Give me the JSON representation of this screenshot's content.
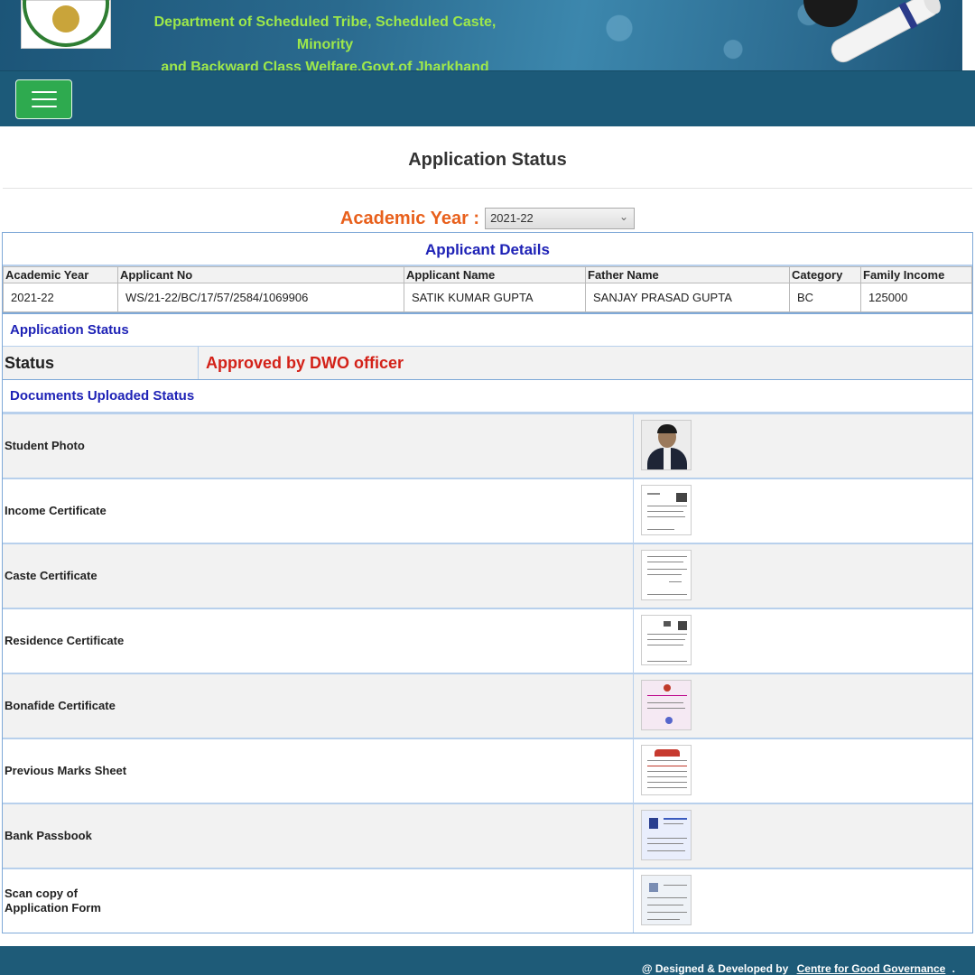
{
  "header": {
    "dept_line1": "Department of Scheduled Tribe, Scheduled Caste, Minority",
    "dept_line2": "and Backward Class Welfare,Govt.of Jharkhand",
    "emblem_icon": "jharkhand-emblem-icon",
    "colors": {
      "banner": "#2a6a8e",
      "dept_text": "#9ee84a",
      "navbar": "#1c5a79",
      "menu_button": "#2eaa4f"
    }
  },
  "navbar": {
    "menu_icon": "hamburger-menu-icon"
  },
  "page": {
    "title": "Application Status",
    "academic_year_label": "Academic Year :",
    "academic_year_selected": "2021-22"
  },
  "applicant": {
    "section_title": "Applicant Details",
    "columns": [
      "Academic Year",
      "Applicant No",
      "Applicant Name",
      "Father Name",
      "Category",
      "Family Income"
    ],
    "row": [
      "2021-22",
      "WS/21-22/BC/17/57/2584/1069906",
      "SATIK KUMAR GUPTA",
      "SANJAY PRASAD GUPTA",
      "BC",
      "125000"
    ]
  },
  "application_status": {
    "section_title": "Application Status",
    "label": "Status",
    "value": "Approved by DWO officer",
    "value_color": "#d32118"
  },
  "documents": {
    "section_title": "Documents Uploaded Status",
    "items": [
      {
        "label": "Student Photo",
        "thumb": "student-photo-thumbnail"
      },
      {
        "label": "Income Certificate",
        "thumb": "income-certificate-thumbnail"
      },
      {
        "label": "Caste Certificate",
        "thumb": "caste-certificate-thumbnail"
      },
      {
        "label": "Residence Certificate",
        "thumb": "residence-certificate-thumbnail"
      },
      {
        "label": "Bonafide Certificate",
        "thumb": "bonafide-certificate-thumbnail"
      },
      {
        "label": "Previous Marks Sheet",
        "thumb": "marks-sheet-thumbnail"
      },
      {
        "label": "Bank Passbook",
        "thumb": "bank-passbook-thumbnail"
      },
      {
        "label": "Scan copy of\nApplication Form",
        "thumb": "application-form-thumbnail"
      }
    ]
  },
  "footer": {
    "prefix": "@ Designed & Developed by",
    "link": "Centre for Good Governance",
    "suffix": "."
  }
}
